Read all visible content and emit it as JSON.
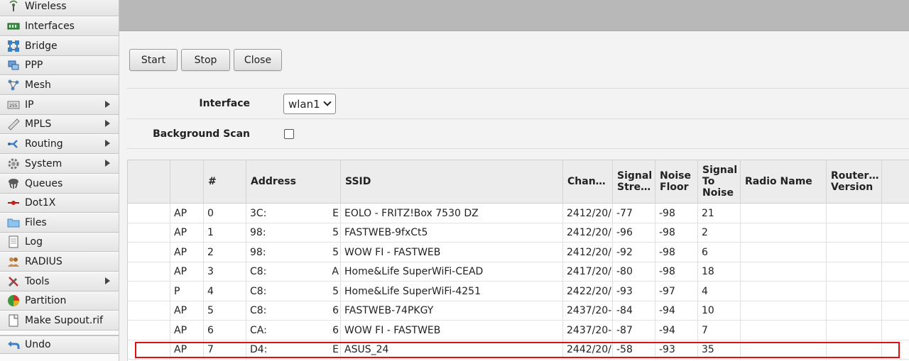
{
  "sidebar": {
    "items": [
      {
        "label": "Wireless",
        "icon": "wireless-icon",
        "submenu": false
      },
      {
        "label": "Interfaces",
        "icon": "interfaces-icon",
        "submenu": false
      },
      {
        "label": "Bridge",
        "icon": "bridge-icon",
        "submenu": false
      },
      {
        "label": "PPP",
        "icon": "ppp-icon",
        "submenu": false
      },
      {
        "label": "Mesh",
        "icon": "mesh-icon",
        "submenu": false
      },
      {
        "label": "IP",
        "icon": "ip-icon",
        "submenu": true
      },
      {
        "label": "MPLS",
        "icon": "mpls-icon",
        "submenu": true
      },
      {
        "label": "Routing",
        "icon": "routing-icon",
        "submenu": true
      },
      {
        "label": "System",
        "icon": "gear-icon",
        "submenu": true
      },
      {
        "label": "Queues",
        "icon": "queues-icon",
        "submenu": false
      },
      {
        "label": "Dot1X",
        "icon": "dot1x-icon",
        "submenu": false
      },
      {
        "label": "Files",
        "icon": "folder-icon",
        "submenu": false
      },
      {
        "label": "Log",
        "icon": "log-icon",
        "submenu": false
      },
      {
        "label": "RADIUS",
        "icon": "radius-icon",
        "submenu": false
      },
      {
        "label": "Tools",
        "icon": "tools-icon",
        "submenu": true
      },
      {
        "label": "Partition",
        "icon": "partition-icon",
        "submenu": false
      },
      {
        "label": "Make Supout.rif",
        "icon": "supout-icon",
        "submenu": false
      },
      {
        "label": "Undo",
        "icon": "undo-icon",
        "submenu": false
      }
    ]
  },
  "toolbar": {
    "start_label": "Start",
    "stop_label": "Stop",
    "close_label": "Close"
  },
  "form": {
    "interface_label": "Interface",
    "interface_value": "wlan1",
    "background_scan_label": "Background Scan",
    "background_scan_checked": false
  },
  "table": {
    "headers": [
      "",
      "",
      "#",
      "Address",
      "SSID",
      "Chan…",
      "Signal Stre…",
      "Noise Floor",
      "Signal To Noise",
      "Radio Name",
      "Router… Version",
      ""
    ],
    "rows": [
      {
        "flags": "AP",
        "num": "0",
        "addr_start": "3C:",
        "addr_end": "E",
        "ssid": "EOLO - FRITZ!Box 7530 DZ",
        "channel": "2412/20/",
        "signal": "-77",
        "noise": "-98",
        "snr": "21"
      },
      {
        "flags": "AP",
        "num": "1",
        "addr_start": "98:",
        "addr_end": "5",
        "ssid": "FASTWEB-9fxCt5",
        "channel": "2412/20/",
        "signal": "-96",
        "noise": "-98",
        "snr": "2"
      },
      {
        "flags": "AP",
        "num": "2",
        "addr_start": "98:",
        "addr_end": "5",
        "ssid": "WOW FI - FASTWEB",
        "channel": "2412/20/",
        "signal": "-92",
        "noise": "-98",
        "snr": "6"
      },
      {
        "flags": "AP",
        "num": "3",
        "addr_start": "C8:",
        "addr_end": "A",
        "ssid": "Home&Life SuperWiFi-CEAD",
        "channel": "2417/20/",
        "signal": "-80",
        "noise": "-98",
        "snr": "18"
      },
      {
        "flags": "P",
        "num": "4",
        "addr_start": "C8:",
        "addr_end": "5",
        "ssid": "Home&Life SuperWiFi-4251",
        "channel": "2422/20/",
        "signal": "-93",
        "noise": "-97",
        "snr": "4"
      },
      {
        "flags": "AP",
        "num": "5",
        "addr_start": "C8:",
        "addr_end": "6",
        "ssid": "FASTWEB-74PKGY",
        "channel": "2437/20-",
        "signal": "-84",
        "noise": "-94",
        "snr": "10"
      },
      {
        "flags": "AP",
        "num": "6",
        "addr_start": "CA:",
        "addr_end": ":6",
        "ssid": "WOW FI - FASTWEB",
        "channel": "2437/20-",
        "signal": "-87",
        "noise": "-94",
        "snr": "7"
      },
      {
        "flags": "AP",
        "num": "7",
        "addr_start": "D4:",
        "addr_end": ":E",
        "ssid": "ASUS_24",
        "channel": "2442/20/",
        "signal": "-58",
        "noise": "-93",
        "snr": "35"
      }
    ]
  },
  "colors": {
    "highlight": "#e01010",
    "topbar": "#b8b8b8",
    "content_bg": "#f3f3f3"
  }
}
